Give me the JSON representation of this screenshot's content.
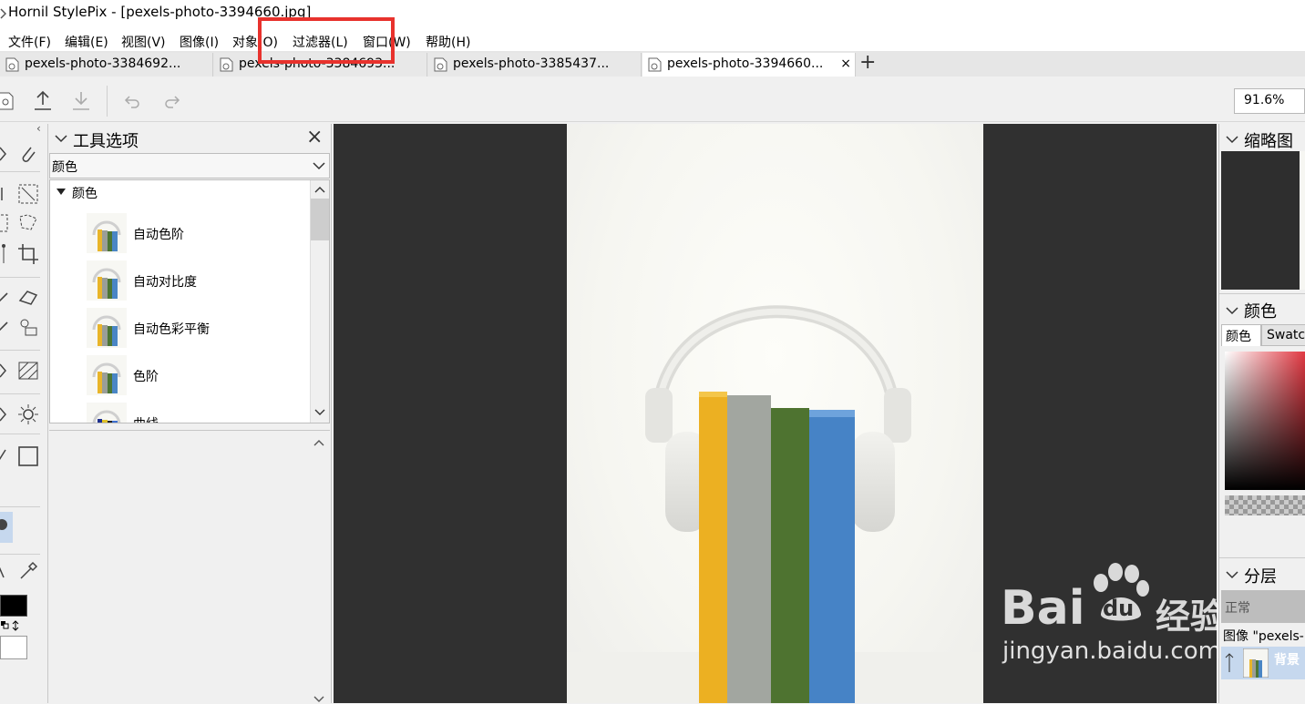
{
  "app": {
    "title": "Hornil StylePix - [pexels-photo-3394660.jpg]"
  },
  "menu": [
    {
      "label": "文件(F)"
    },
    {
      "label": "编辑(E)"
    },
    {
      "label": "视图(V)"
    },
    {
      "label": "图像(I)"
    },
    {
      "label": "对象(O)"
    },
    {
      "label": "过滤器(L)"
    },
    {
      "label": "窗口(W)"
    },
    {
      "label": "帮助(H)"
    }
  ],
  "tabs": [
    {
      "label": "pexels-photo-3384692...",
      "active": false
    },
    {
      "label": "pexels-photo-3384693...",
      "active": false
    },
    {
      "label": "pexels-photo-3385437...",
      "active": false
    },
    {
      "label": "pexels-photo-3394660...",
      "active": true,
      "close": "×"
    }
  ],
  "tab_add": "+",
  "toolbar": {
    "zoom": "91.6%"
  },
  "tool_options": {
    "title": "工具选项",
    "close": "×",
    "category_select": "颜色",
    "group_label": "颜色",
    "items": [
      {
        "label": "自动色阶"
      },
      {
        "label": "自动对比度"
      },
      {
        "label": "自动色彩平衡"
      },
      {
        "label": "色阶"
      },
      {
        "label": "曲线"
      }
    ]
  },
  "right_panel": {
    "thumbnail_title": "缩略图",
    "color_title": "颜色",
    "color_tabs": [
      {
        "label": "颜色"
      },
      {
        "label": "Swatc"
      }
    ],
    "layers_title": "分层",
    "blend_mode": "正常",
    "image_label": "图像 \"pexels-",
    "layer_name": "背景"
  },
  "watermark": {
    "brand": "Bai",
    "brand2": "du",
    "cn": "经验",
    "url": "jingyan.baidu.com"
  },
  "colors": {
    "highlight": "#e8322d",
    "canvas_bg": "#303030",
    "accent": "#c6d8ee"
  }
}
